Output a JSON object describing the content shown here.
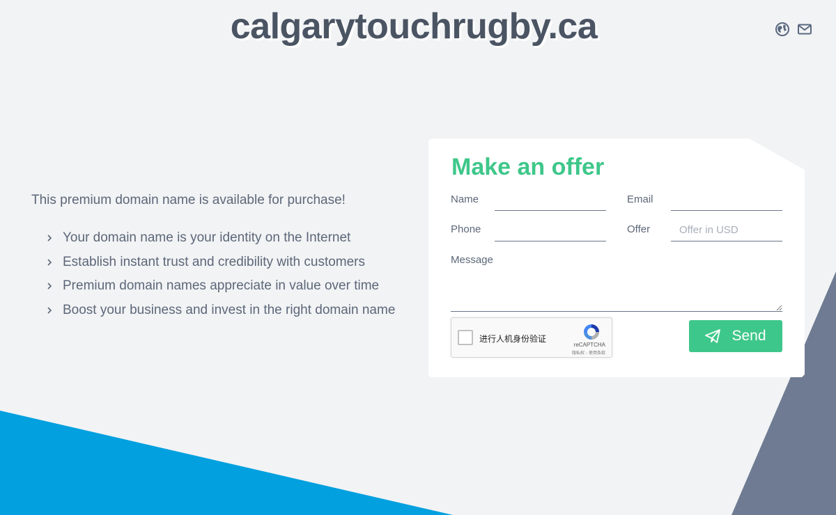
{
  "site": {
    "title": "calgarytouchrugby.ca"
  },
  "header": {
    "icons": [
      {
        "name": "globe-icon"
      },
      {
        "name": "mail-icon"
      }
    ]
  },
  "intro": {
    "text": "This premium domain name is available for purchase!",
    "features": [
      "Your domain name is your identity on the Internet",
      "Establish instant trust and credibility with customers",
      "Premium domain names appreciate in value over time",
      "Boost your business and invest in the right domain name"
    ]
  },
  "offer_form": {
    "title": "Make an offer",
    "fields": {
      "name": {
        "label": "Name",
        "value": "",
        "placeholder": ""
      },
      "email": {
        "label": "Email",
        "value": "",
        "placeholder": ""
      },
      "phone": {
        "label": "Phone",
        "value": "",
        "placeholder": ""
      },
      "offer": {
        "label": "Offer",
        "value": "",
        "placeholder": "Offer in USD"
      },
      "message": {
        "label": "Message",
        "value": ""
      }
    },
    "recaptcha": {
      "label": "进行人机身份验证",
      "brand": "reCAPTCHA",
      "terms": "隐私权 - 使用条款"
    },
    "send_label": "Send"
  },
  "colors": {
    "accent": "#3ec78a",
    "title_text": "#4a5463",
    "background": "#f2f3f5",
    "shape_blue": "#02a0df",
    "shape_gray": "#6e7b92"
  }
}
